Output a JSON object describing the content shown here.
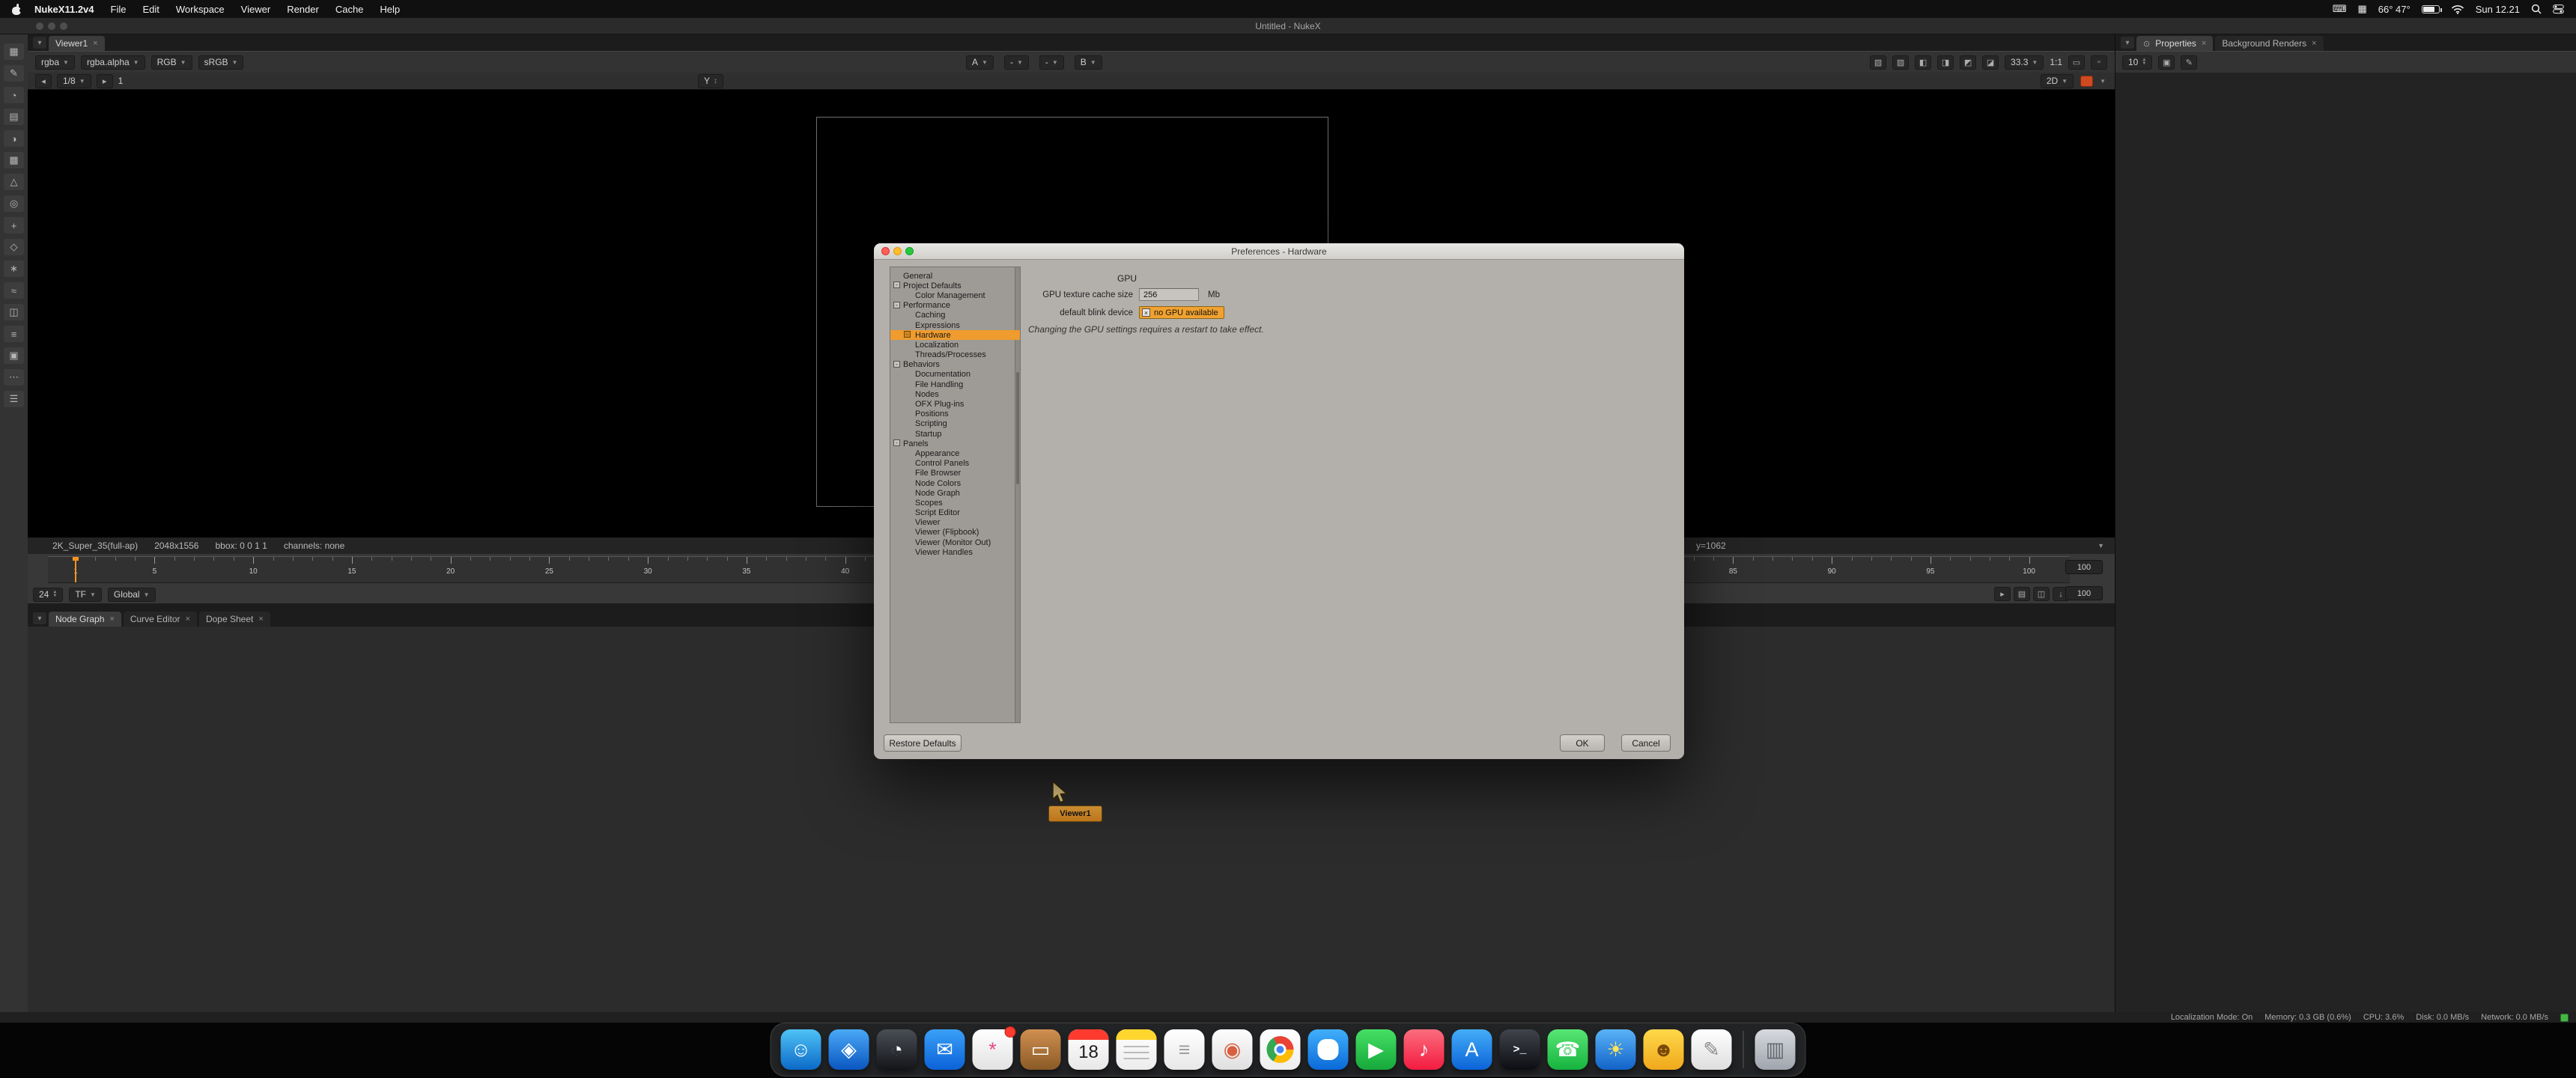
{
  "colors": {
    "accent_orange": "#f7941d",
    "selection_orange": "#ef9b2d",
    "status_green": "#44b744",
    "node_orange_1": "#f2a93c",
    "node_orange_2": "#cd7f1d"
  },
  "menu_bar": {
    "items": [
      "NukeX11.2v4",
      "File",
      "Edit",
      "Workspace",
      "Viewer",
      "Render",
      "Cache",
      "Help"
    ],
    "status": {
      "temperature": "66° 47°",
      "date": "Sun 12.21"
    }
  },
  "window": {
    "title": "Untitled - NukeX",
    "viewer_tab": "Viewer1"
  },
  "left_toolbar": {
    "icons": [
      {
        "name": "image-tools-icon",
        "glyph": "▦"
      },
      {
        "name": "draw-tools-icon",
        "glyph": "✎"
      },
      {
        "name": "time-tools-icon",
        "glyph": "◔"
      },
      {
        "name": "channel-tools-icon",
        "glyph": "▤"
      },
      {
        "name": "color-tools-icon",
        "glyph": "◑"
      },
      {
        "name": "filter-tools-icon",
        "glyph": "▩"
      },
      {
        "name": "keyer-tools-icon",
        "glyph": "△"
      },
      {
        "name": "merge-tools-icon",
        "glyph": "◎"
      },
      {
        "name": "transform-tools-icon",
        "glyph": "+"
      },
      {
        "name": "3d-tools-icon",
        "glyph": "◇"
      },
      {
        "name": "particles-tools-icon",
        "glyph": "∗"
      },
      {
        "name": "deep-tools-icon",
        "glyph": "≈"
      },
      {
        "name": "views-tools-icon",
        "glyph": "◫"
      },
      {
        "name": "metadata-tools-icon",
        "glyph": "≡"
      },
      {
        "name": "toolsets-tools-icon",
        "glyph": "▣"
      },
      {
        "name": "other-tools-icon",
        "glyph": "⋯"
      },
      {
        "name": "scripts-tools-icon",
        "glyph": "☰"
      }
    ]
  },
  "viewer": {
    "layer": "rgba",
    "channel": "rgba.alpha",
    "display_channels": "RGB",
    "viewer_colorspace": "sRGB",
    "buffer_a": "A",
    "wipe": "-",
    "blend": "-",
    "buffer_b": "B",
    "zoom": "33.3",
    "pixel_ratio": "1:1",
    "downrez": "1/8",
    "frame_increment": "1",
    "axis": "Y",
    "view_mode": "2D",
    "info_segments": [
      "2K_Super_35(full-ap)",
      "2048x1556",
      "bbox: 0 0 1 1",
      "channels: none"
    ],
    "cursor_pos": "y=1062"
  },
  "timeline": {
    "current_frame": "1",
    "first_frame": 1,
    "last_frame": 100,
    "label_interval": 5,
    "fps": "24",
    "fps_mode": "TF",
    "range_mode": "Global",
    "range_end": "100",
    "playback_end": "100"
  },
  "bottom_tabs": [
    {
      "label": "Node Graph"
    },
    {
      "label": "Curve Editor"
    },
    {
      "label": "Dope Sheet"
    }
  ],
  "node_graph": {
    "node_label": "Viewer1"
  },
  "right_panel": {
    "tabs": [
      {
        "label": "Properties"
      },
      {
        "label": "Background Renders"
      }
    ],
    "max_nodes": "10"
  },
  "preferences_dialog": {
    "title": "Preferences - Hardware",
    "tree": [
      {
        "label": "General",
        "depth": 0
      },
      {
        "label": "Project Defaults",
        "depth": 0,
        "toggle": "-"
      },
      {
        "label": "Color Management",
        "depth": 1
      },
      {
        "label": "Performance",
        "depth": 0,
        "toggle": "-"
      },
      {
        "label": "Caching",
        "depth": 1
      },
      {
        "label": "Expressions",
        "depth": 1
      },
      {
        "label": "Hardware",
        "depth": 1,
        "toggle": "-",
        "selected": true
      },
      {
        "label": "Localization",
        "depth": 1
      },
      {
        "label": "Threads/Processes",
        "depth": 1
      },
      {
        "label": "Behaviors",
        "depth": 0,
        "toggle": "-"
      },
      {
        "label": "Documentation",
        "depth": 1
      },
      {
        "label": "File Handling",
        "depth": 1
      },
      {
        "label": "Nodes",
        "depth": 1
      },
      {
        "label": "OFX Plug-ins",
        "depth": 1
      },
      {
        "label": "Positions",
        "depth": 1
      },
      {
        "label": "Scripting",
        "depth": 1
      },
      {
        "label": "Startup",
        "depth": 1
      },
      {
        "label": "Panels",
        "depth": 0,
        "toggle": "-"
      },
      {
        "label": "Appearance",
        "depth": 1
      },
      {
        "label": "Control Panels",
        "depth": 1
      },
      {
        "label": "File Browser",
        "depth": 1
      },
      {
        "label": "Node Colors",
        "depth": 1
      },
      {
        "label": "Node Graph",
        "depth": 1
      },
      {
        "label": "Scopes",
        "depth": 1
      },
      {
        "label": "Script Editor",
        "depth": 1
      },
      {
        "label": "Viewer",
        "depth": 1
      },
      {
        "label": "Viewer (Flipbook)",
        "depth": 1
      },
      {
        "label": "Viewer (Monitor Out)",
        "depth": 1
      },
      {
        "label": "Viewer Handles",
        "depth": 1
      }
    ],
    "content": {
      "heading": "GPU",
      "cache_label": "GPU texture cache size",
      "cache_value": "256",
      "cache_unit": "Mb",
      "blink_label": "default blink device",
      "blink_value": "no GPU available",
      "note": "Changing the GPU settings requires a restart to take effect."
    },
    "buttons": {
      "restore": "Restore Defaults",
      "ok": "OK",
      "cancel": "Cancel"
    }
  },
  "status_bar": {
    "segments": [
      "Localization Mode: On",
      "Memory: 0.3 GB (0.6%)",
      "CPU: 3.6%",
      "Disk: 0.0 MB/s",
      "Network: 0.0 MB/s"
    ]
  },
  "dock": {
    "items": [
      {
        "name": "finder-dock-icon",
        "glyph": "☺",
        "bg1": "#4fc3f7",
        "bg2": "#0b69c7",
        "fg": "#ffffff"
      },
      {
        "name": "safari-dock-icon",
        "glyph": "◈",
        "bg1": "#4aa9f7",
        "bg2": "#0a56c0",
        "fg": "#ffffff"
      },
      {
        "name": "clock-dock-icon",
        "glyph": "◔",
        "bg1": "#4a4e55",
        "bg2": "#141519",
        "fg": "#ffffff"
      },
      {
        "name": "mail-dock-icon",
        "glyph": "✉",
        "bg1": "#3aa0f8",
        "bg2": "#0b62d8",
        "fg": "#ffffff"
      },
      {
        "name": "photos-dock-icon",
        "glyph": "*",
        "bg1": "#ffffff",
        "bg2": "#e2e2e2",
        "fg": "#e84a8a",
        "badge": true
      },
      {
        "name": "preview-dock-icon",
        "glyph": "▭",
        "bg1": "#d09050",
        "bg2": "#8a5a26",
        "fg": "#ffffff"
      },
      {
        "name": "calendar-dock-icon",
        "day": "18",
        "bg1": "#ffffff",
        "bg2": "#e8e8e8",
        "cls": "cal"
      },
      {
        "name": "notes-dock-icon",
        "bg1": "#ffffff",
        "bg2": "#ececec",
        "cls": "notes"
      },
      {
        "name": "reminders-dock-icon",
        "glyph": "≡",
        "bg1": "#ffffff",
        "bg2": "#e8e8e8",
        "fg": "#9a9aa0"
      },
      {
        "name": "photo-booth-dock-icon",
        "glyph": "◉",
        "bg1": "#fdfdfd",
        "bg2": "#dfdfdf",
        "fg": "#d85f3f"
      },
      {
        "name": "chrome-dock-icon",
        "cls": "chrome",
        "bg1": "#ffffff",
        "bg2": "#eeeeee"
      },
      {
        "name": "messages-dock-icon",
        "cls": "bubble",
        "bg1": "#41b0fb",
        "bg2": "#0a69d8"
      },
      {
        "name": "facetime-dock-icon",
        "glyph": "▶",
        "bg1": "#46e065",
        "bg2": "#16a83a",
        "fg": "#ffffff"
      },
      {
        "name": "music-dock-icon",
        "glyph": "♪",
        "bg1": "#fb6d7e",
        "bg2": "#f31b3f",
        "fg": "#ffffff"
      },
      {
        "name": "app-store-dock-icon",
        "glyph": "A",
        "bg1": "#44aef8",
        "bg2": "#0b63d8",
        "fg": "#ffffff"
      },
      {
        "name": "terminal-dock-icon",
        "glyph": "&gt;_",
        "bg1": "#40444c",
        "bg2": "#0c0e12",
        "fg": "#ffffff",
        "cls": "mono"
      },
      {
        "name": "whatsapp-dock-icon",
        "glyph": "☎",
        "bg1": "#58e675",
        "bg2": "#16b33e",
        "fg": "#ffffff"
      },
      {
        "name": "weather-dock-icon",
        "glyph": "☀",
        "bg1": "#5ab3f8",
        "bg2": "#1262c8",
        "fg": "#ffe35a"
      },
      {
        "name": "game-dock-icon",
        "glyph": "☻",
        "bg1": "#ffd94a",
        "bg2": "#f0a81c",
        "fg": "#7a4a08"
      },
      {
        "name": "textedit-dock-icon",
        "glyph": "✎",
        "bg1": "#ffffff",
        "bg2": "#dedede",
        "fg": "#8a8a8a"
      },
      {
        "name": "trash-dock-icon",
        "glyph": "▥",
        "bg1": "#e6e9ee",
        "bg2": "#aab0b9",
        "fg": "#6a7078",
        "cls": "trash"
      }
    ]
  }
}
